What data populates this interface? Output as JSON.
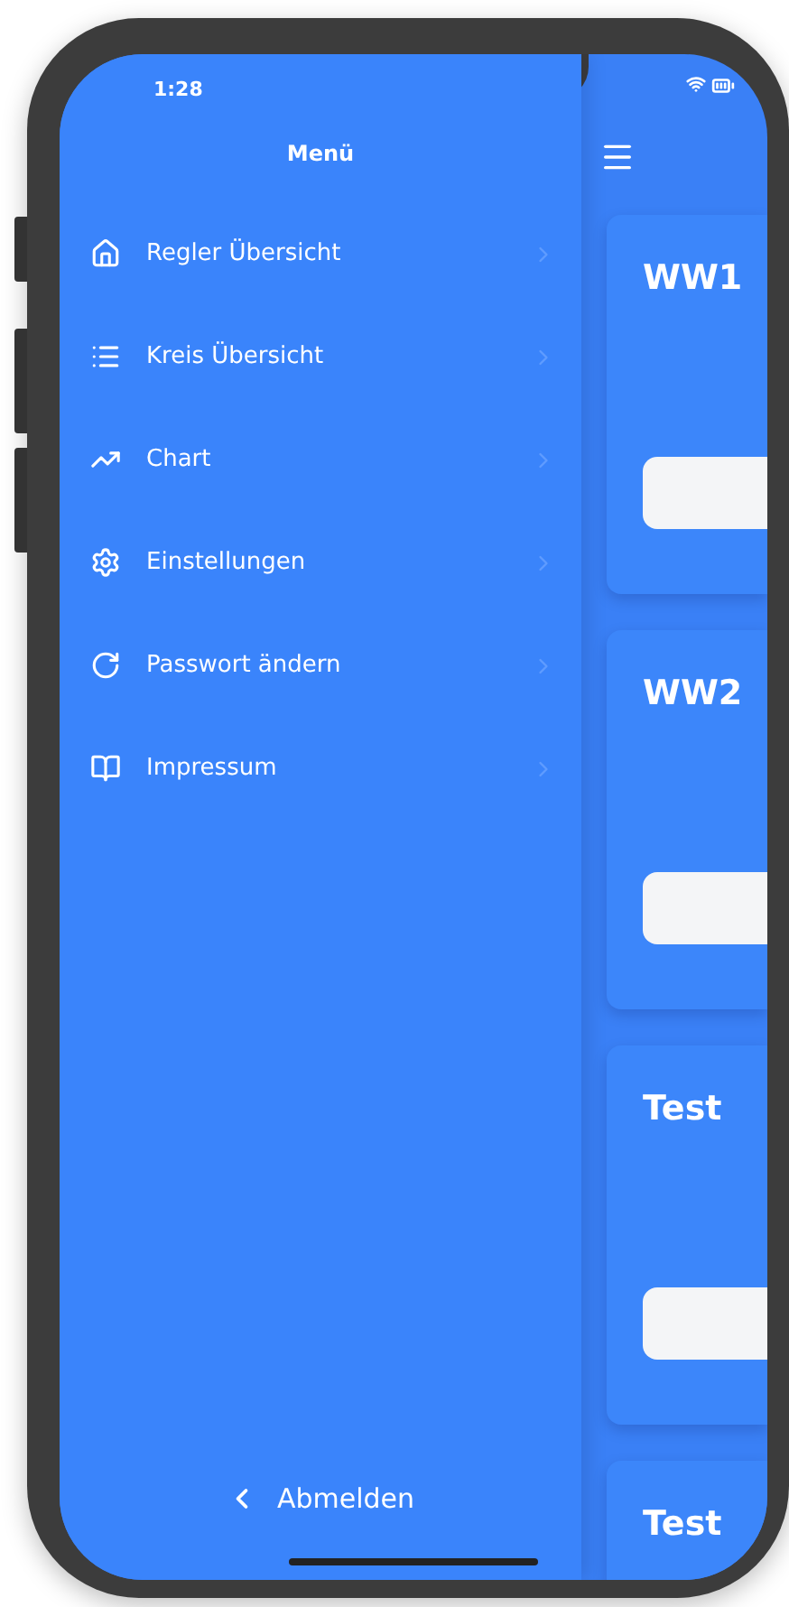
{
  "status_bar": {
    "time": "1:28"
  },
  "drawer": {
    "title": "Menü",
    "items": [
      {
        "label": "Regler Übersicht"
      },
      {
        "label": "Kreis Übersicht"
      },
      {
        "label": "Chart"
      },
      {
        "label": "Einstellungen"
      },
      {
        "label": "Passwort ändern"
      },
      {
        "label": "Impressum"
      }
    ],
    "logout": "Abmelden"
  },
  "main": {
    "cards": [
      {
        "title": "WW1"
      },
      {
        "title": "WW2"
      },
      {
        "title": "Test"
      },
      {
        "title": "Test"
      }
    ]
  }
}
